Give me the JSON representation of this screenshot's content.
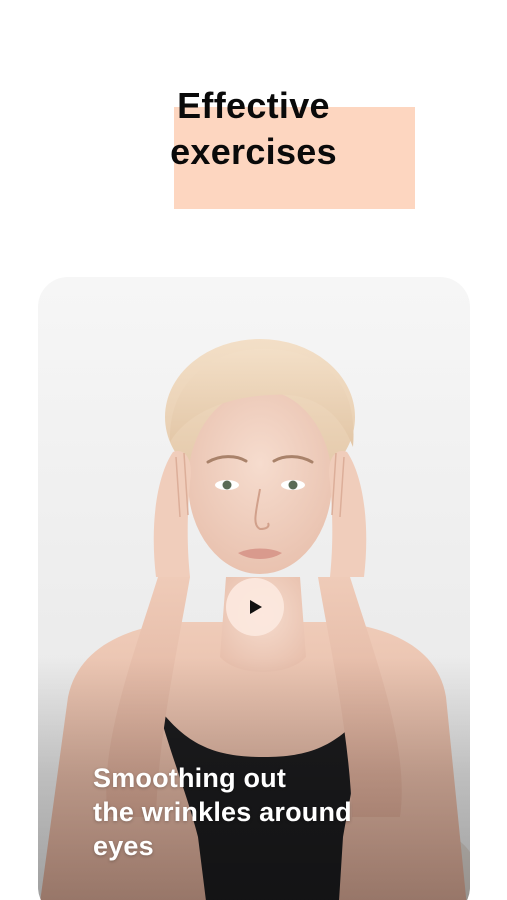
{
  "header": {
    "title_lines": [
      "Effective",
      "exercises"
    ]
  },
  "video_card": {
    "image": "woman-face-massage-photo",
    "play_icon": "play-icon",
    "caption_lines": [
      "Smoothing out",
      "the wrinkles around",
      "eyes"
    ]
  },
  "colors": {
    "accent": "#fdd6c0",
    "play_button_bg": "#fce8de",
    "headline": "#0a0a0a",
    "caption": "#ffffff"
  }
}
